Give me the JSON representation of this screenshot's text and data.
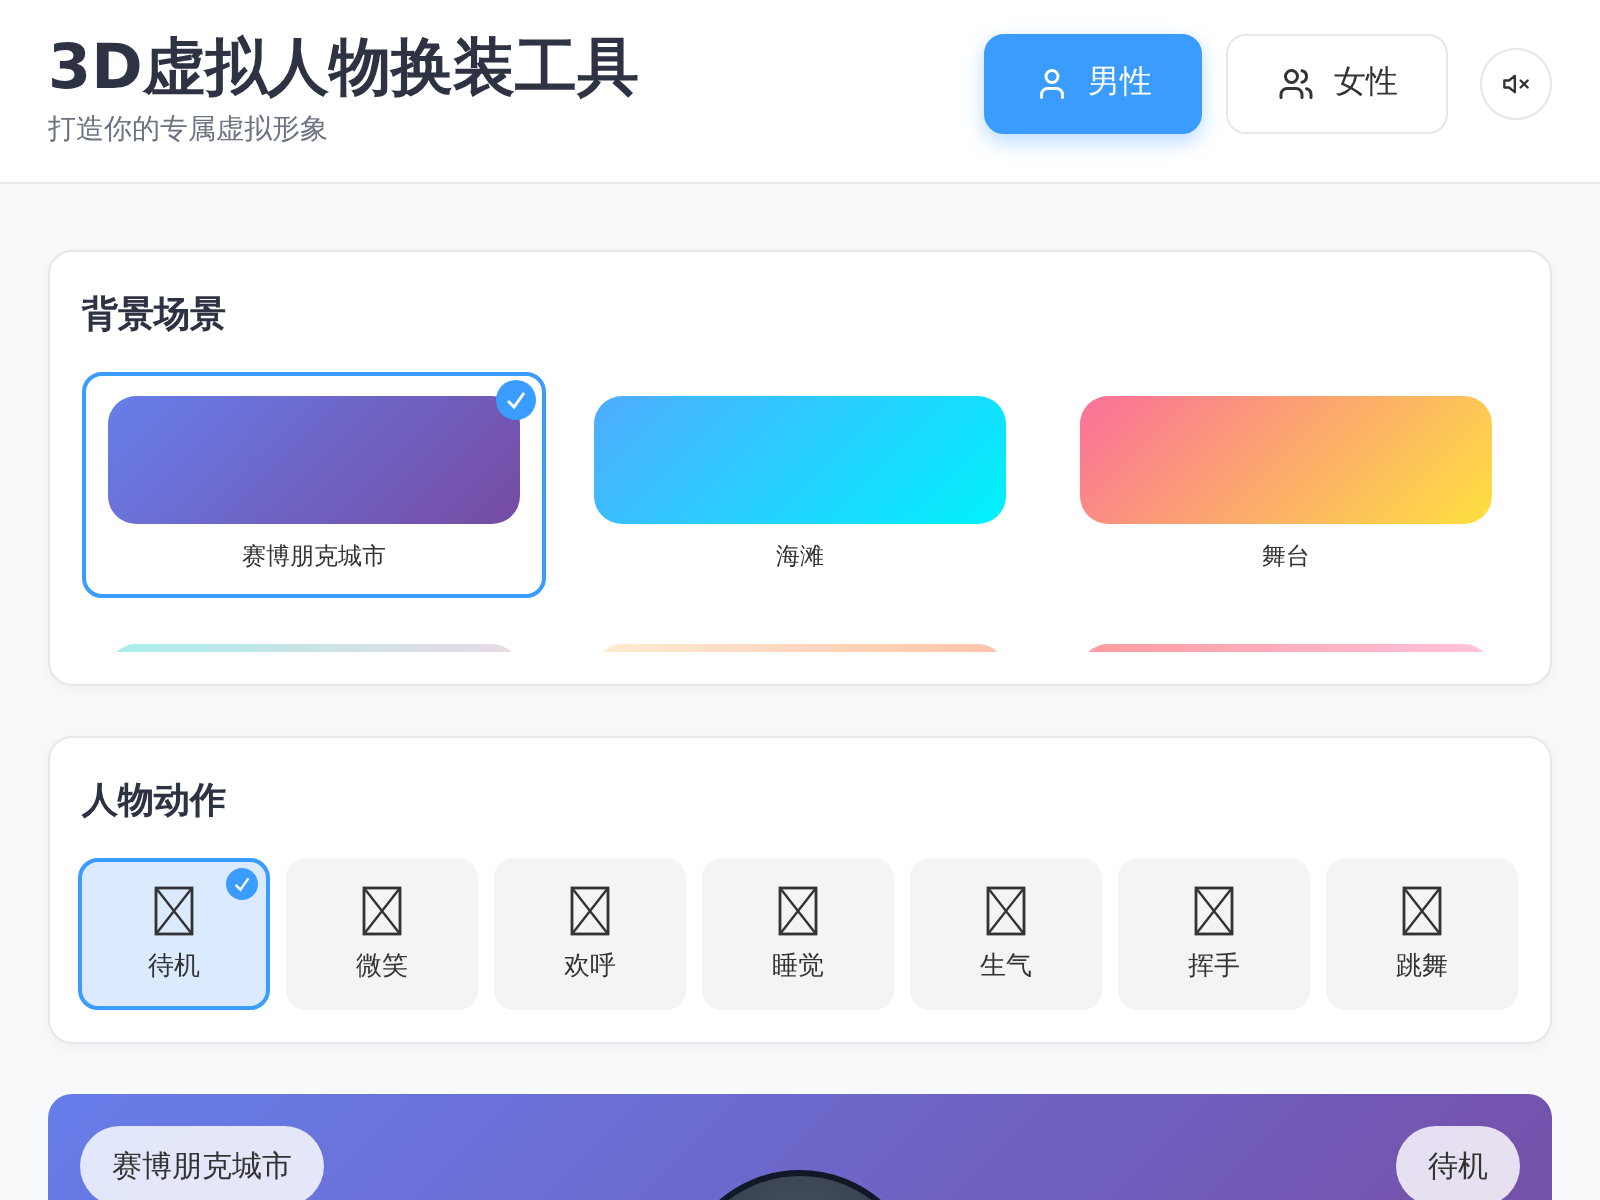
{
  "header": {
    "title": "3D虚拟人物换装工具",
    "subtitle": "打造你的专属虚拟形象"
  },
  "gender_buttons": [
    {
      "label": "男性",
      "kind": "single",
      "selected": true
    },
    {
      "label": "女性",
      "kind": "group",
      "selected": false
    }
  ],
  "sound": {
    "muted": true
  },
  "scenes": {
    "title": "背景场景",
    "items": [
      {
        "label": "赛博朋克城市",
        "kind": "cyber",
        "selected": true
      },
      {
        "label": "海滩",
        "kind": "beach",
        "selected": false
      },
      {
        "label": "舞台",
        "kind": "stage",
        "selected": false
      },
      {
        "kind": "mint",
        "selected": false
      },
      {
        "kind": "peach",
        "selected": false
      },
      {
        "kind": "rose",
        "selected": false
      }
    ]
  },
  "actions": {
    "title": "人物动作",
    "items": [
      {
        "label": "待机",
        "selected": true
      },
      {
        "label": "微笑",
        "selected": false
      },
      {
        "label": "欢呼",
        "selected": false
      },
      {
        "label": "睡觉",
        "selected": false
      },
      {
        "label": "生气",
        "selected": false
      },
      {
        "label": "挥手",
        "selected": false
      },
      {
        "label": "跳舞",
        "selected": false
      }
    ]
  },
  "preview": {
    "scene_label": "赛博朋克城市",
    "action_label": "待机"
  }
}
